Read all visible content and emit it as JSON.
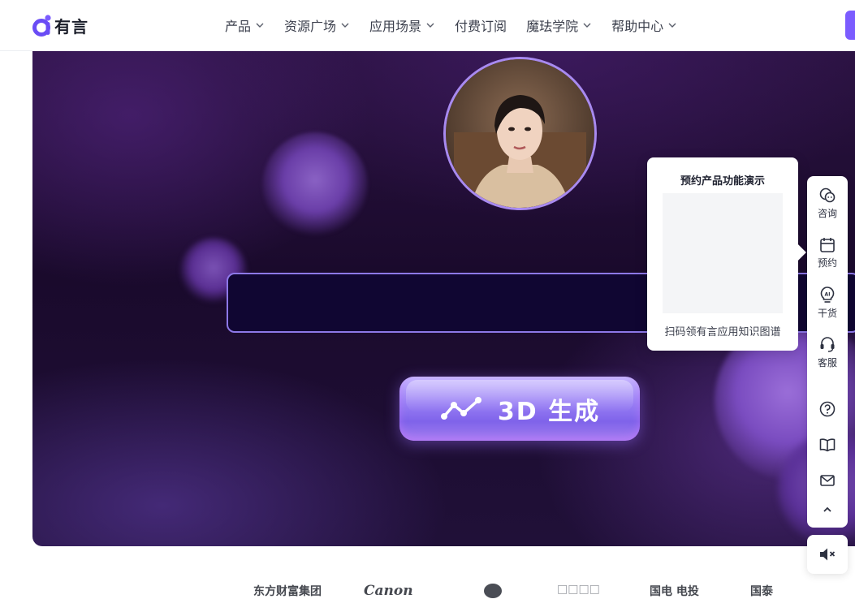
{
  "header": {
    "logo_text": "有言",
    "nav": [
      {
        "label": "产品",
        "dropdown": true
      },
      {
        "label": "资源广场",
        "dropdown": true
      },
      {
        "label": "应用场景",
        "dropdown": true
      },
      {
        "label": "付费订阅",
        "dropdown": false
      },
      {
        "label": "魔珐学院",
        "dropdown": true
      },
      {
        "label": "帮助中心",
        "dropdown": true
      }
    ]
  },
  "hero": {
    "input": {
      "value": "",
      "placeholder": ""
    },
    "generate_button_label": "3D 生成"
  },
  "qr_popover": {
    "title": "预约产品功能演示",
    "caption": "扫码领有言应用知识图谱"
  },
  "side_toolbar": {
    "items": [
      {
        "icon": "consult-icon",
        "label": "咨询"
      },
      {
        "icon": "calendar-icon",
        "label": "预约"
      },
      {
        "icon": "ai-bulb-icon",
        "label": "干货"
      },
      {
        "icon": "headset-icon",
        "label": "客服"
      },
      {
        "icon": "help-icon",
        "label": ""
      },
      {
        "icon": "book-icon",
        "label": ""
      },
      {
        "icon": "mail-icon",
        "label": ""
      },
      {
        "icon": "chevron-up-icon",
        "label": ""
      }
    ],
    "sound_icon": "speaker-muted-icon"
  },
  "partner_logos": [
    "东方财富集团",
    "Canon",
    "",
    "□□□□",
    "国电 电投",
    "国泰"
  ],
  "colors": {
    "brand": "#7b5cff",
    "hero_bg": "#1a0a2c",
    "input_border": "#8d78e8"
  }
}
